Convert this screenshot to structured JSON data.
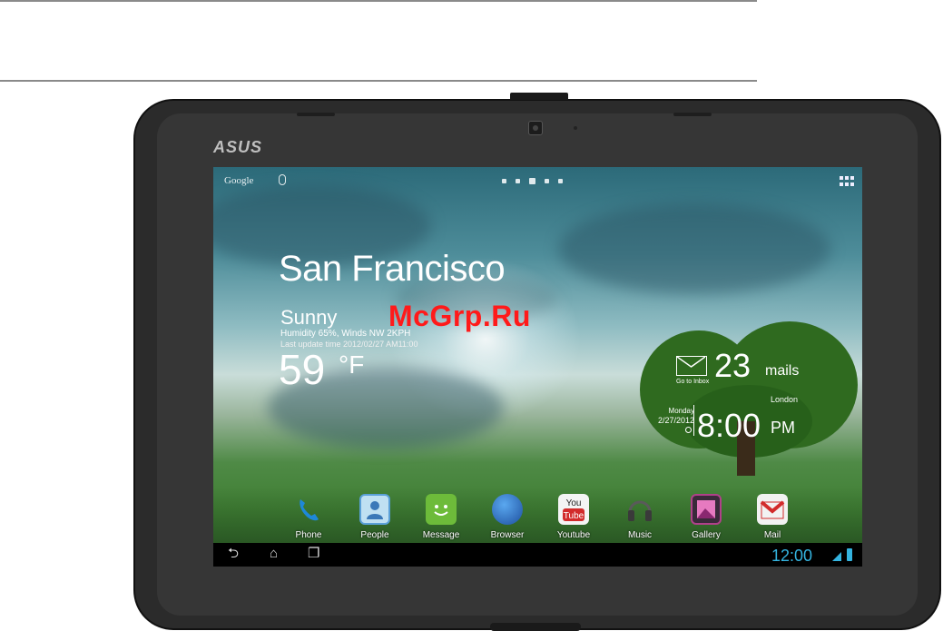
{
  "page": {
    "watermark": "McGrp.Ru",
    "brand": "ASUS"
  },
  "screen": {
    "search_label": "Google",
    "weather": {
      "city": "San Francisco",
      "condition": "Sunny",
      "details": "Humidity 65%, Winds NW 2KPH",
      "last_update": "Last update time 2012/02/27 AM11:00",
      "temp": "59",
      "unit": "°F"
    },
    "mail": {
      "count": "23",
      "label": "mails",
      "link": "Go to Inbox"
    },
    "clock_widget": {
      "city": "London",
      "day": "Monday",
      "date": "2/27/2012",
      "time": "8:00",
      "ampm": "PM"
    },
    "dock_apps": [
      {
        "label": "Phone",
        "icon": "phone-icon",
        "color": "#1e88d8"
      },
      {
        "label": "People",
        "icon": "people-icon",
        "color": "#5aa0d8"
      },
      {
        "label": "Message",
        "icon": "message-icon",
        "color": "#6dbb3a"
      },
      {
        "label": "Browser",
        "icon": "browser-icon",
        "color": "#2b6cc4"
      },
      {
        "label": "Youtube",
        "icon": "youtube-icon",
        "color": "#d22b2b"
      },
      {
        "label": "Music",
        "icon": "music-icon",
        "color": "#6b6b6b"
      },
      {
        "label": "Gallery",
        "icon": "gallery-icon",
        "color": "#b0408a"
      },
      {
        "label": "Mail",
        "icon": "gmail-icon",
        "color": "#e8e8e8"
      }
    ],
    "status": {
      "time": "12:00",
      "accent": "#34b4e0"
    }
  }
}
